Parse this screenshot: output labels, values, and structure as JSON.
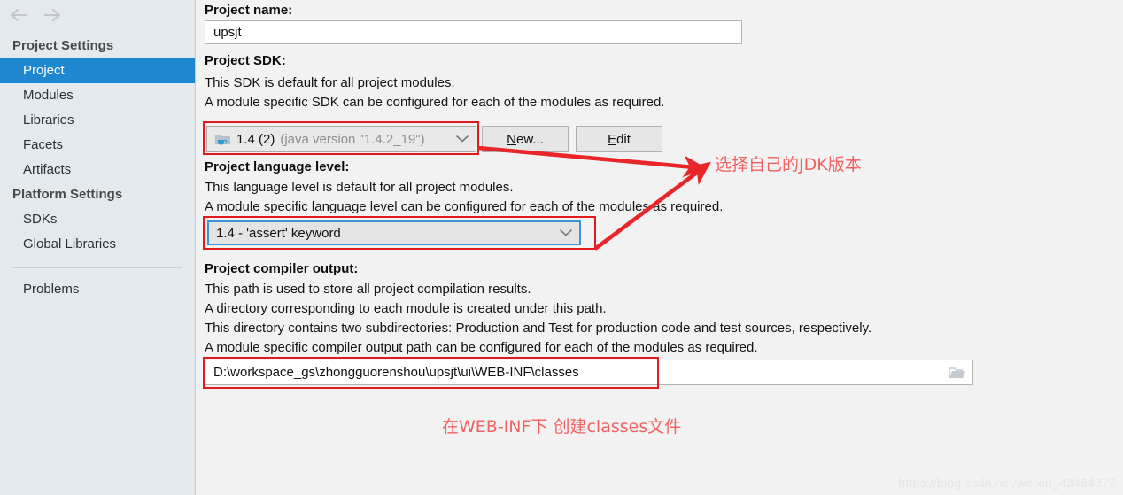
{
  "sidebar": {
    "back_icon": "arrow-left-icon",
    "forward_icon": "arrow-right-icon",
    "groups": [
      {
        "title": "Project Settings",
        "items": [
          {
            "label": "Project",
            "selected": true
          },
          {
            "label": "Modules",
            "selected": false
          },
          {
            "label": "Libraries",
            "selected": false
          },
          {
            "label": "Facets",
            "selected": false
          },
          {
            "label": "Artifacts",
            "selected": false
          }
        ]
      },
      {
        "title": "Platform Settings",
        "items": [
          {
            "label": "SDKs",
            "selected": false
          },
          {
            "label": "Global Libraries",
            "selected": false
          }
        ]
      }
    ],
    "problems_label": "Problems",
    "selected_color": "#1f87d0",
    "background_color": "#e4e9ee"
  },
  "main": {
    "project_name": {
      "label": "Project name:",
      "value": "upsjt"
    },
    "project_sdk": {
      "label": "Project SDK:",
      "desc_line1": "This SDK is default for all project modules.",
      "desc_line2": "A module specific SDK can be configured for each of the modules as required.",
      "sdk_icon": "java-sdk-folder-icon",
      "value_main": "1.4 (2)",
      "value_detail": "(java version \"1.4.2_19\")",
      "new_button": "New...",
      "new_button_mnemonic": "N",
      "edit_button": "Edit",
      "edit_button_mnemonic": "E"
    },
    "language_level": {
      "label": "Project language level:",
      "desc_line1": "This language level is default for all project modules.",
      "desc_line2": "A module specific language level can be configured for each of the modules as required.",
      "value": "1.4 - 'assert' keyword"
    },
    "compiler_output": {
      "label": "Project compiler output:",
      "desc_line1": "This path is used to store all project compilation results.",
      "desc_line2": "A directory corresponding to each module is created under this path.",
      "desc_line3": "This directory contains two subdirectories: Production and Test for production code and test sources, respectively.",
      "desc_line4": "A module specific compiler output path can be configured for each of the modules as required.",
      "value": "D:\\workspace_gs\\zhongguorenshou\\upsjt\\ui\\WEB-INF\\classes",
      "browse_icon": "folder-open-icon"
    }
  },
  "annotations": {
    "highlight_color": "#e01b1b",
    "note_color": "#f06262",
    "note_sdk": "选择自己的JDK版本",
    "note_classes": "在WEB-INF下  创建classes文件",
    "arrow_icon": "red-arrow-icon"
  },
  "watermark": {
    "text": "https://blog.csdn.net/weixin_43464372"
  }
}
